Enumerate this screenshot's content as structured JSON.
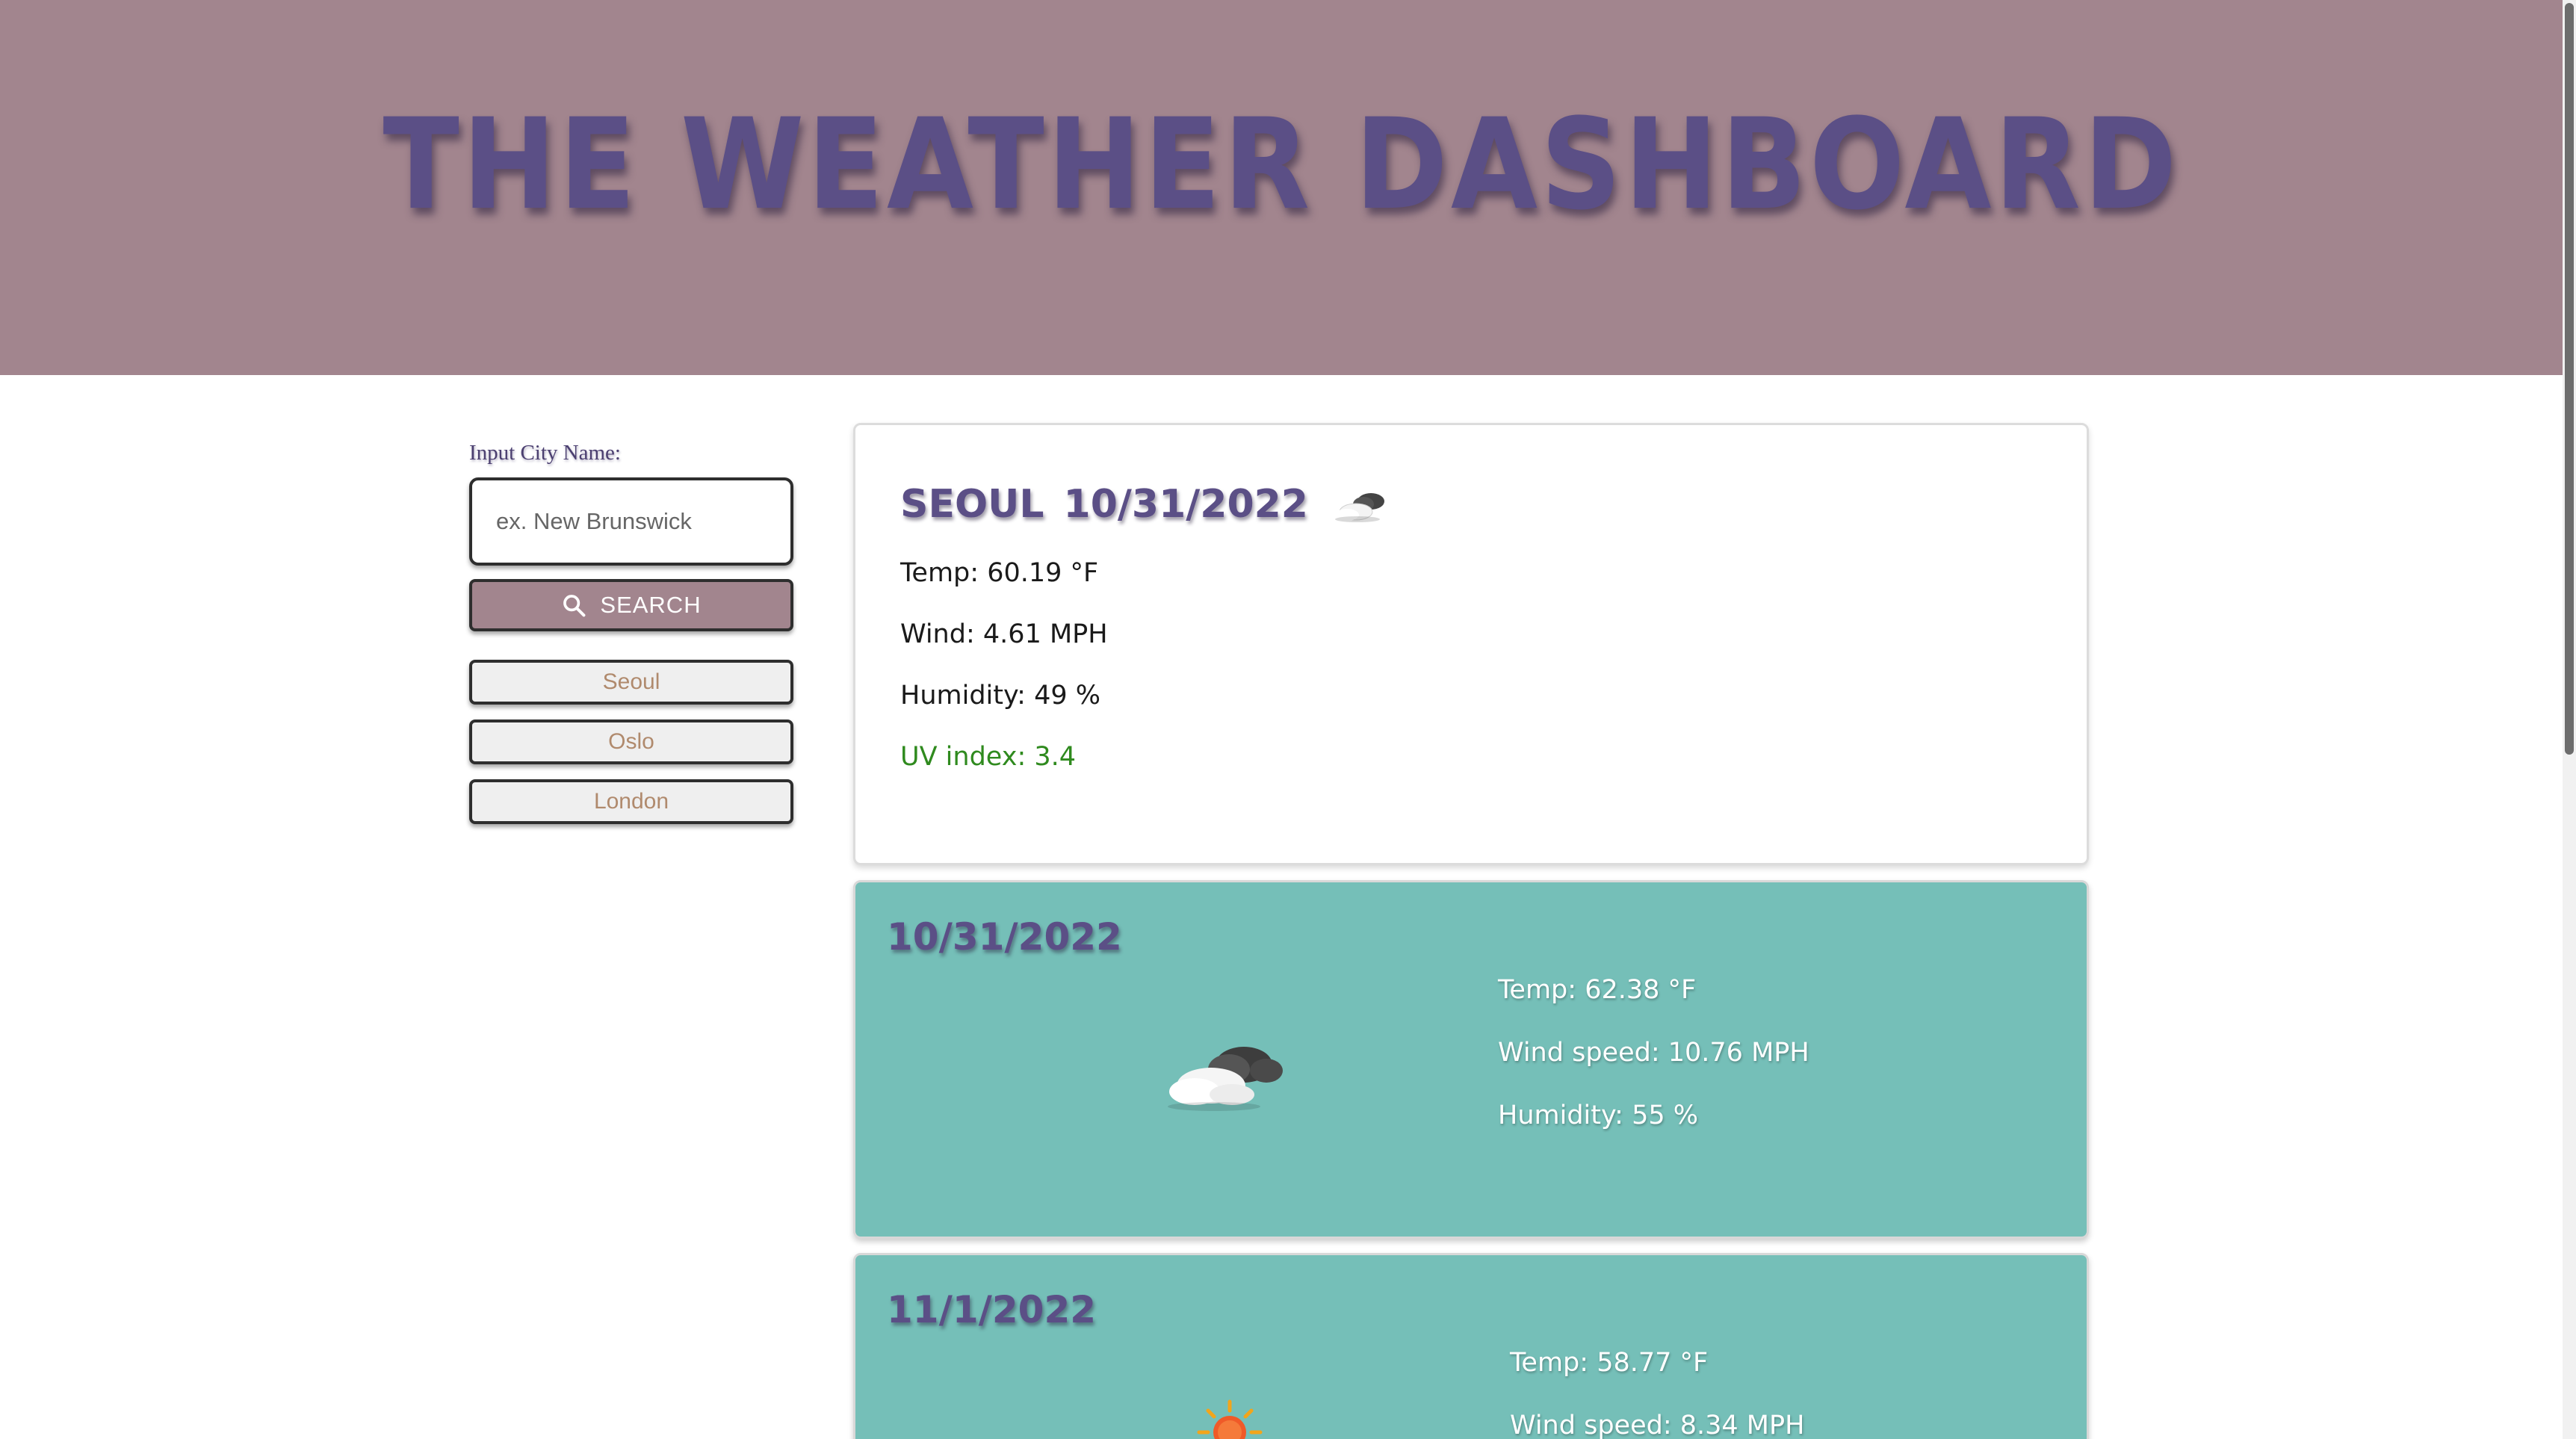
{
  "header": {
    "title": "THE WEATHER DASHBOARD"
  },
  "search": {
    "label": "Input City Name:",
    "placeholder": "ex. New Brunswick",
    "button_label": "SEARCH",
    "history": [
      "Seoul",
      "Oslo",
      "London"
    ]
  },
  "current": {
    "city": "SEOUL",
    "date": "10/31/2022",
    "icon": "cloud-sun-icon",
    "temp_label": "Temp:",
    "temp_value": "60.19 °F",
    "wind_label": "Wind:",
    "wind_value": "4.61 MPH",
    "humidity_label": "Humidity:",
    "humidity_value": "49 %",
    "uv": "UV index: 3.4"
  },
  "forecast": [
    {
      "date": "10/31/2022",
      "icon": "clouds-icon",
      "temp": "Temp: 62.38 °F",
      "wind": "Wind speed: 10.76 MPH",
      "humidity": "Humidity: 55 %"
    },
    {
      "date": "11/1/2022",
      "icon": "sun-icon",
      "temp": "Temp: 58.77 °F",
      "wind": "Wind speed: 8.34 MPH"
    }
  ],
  "colors": {
    "header_bg": "#a2858e",
    "title": "#5b4f86",
    "forecast_bg": "#75bfb8",
    "uv_good": "#2f8a1e"
  }
}
